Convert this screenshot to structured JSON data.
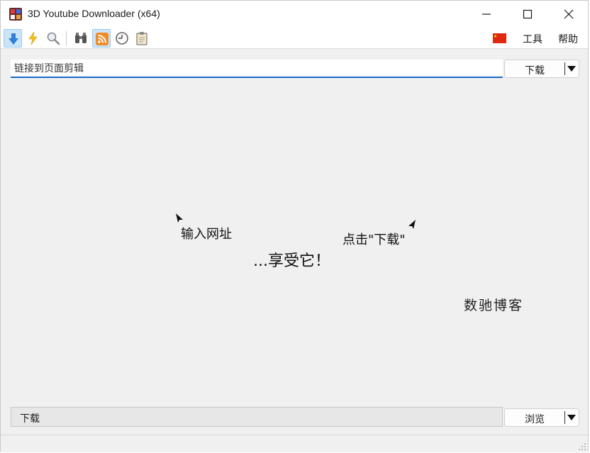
{
  "window": {
    "title": "3D Youtube Downloader (x64)",
    "app_icon": "app-logo-icon"
  },
  "titlebar_controls": [
    "minimize-icon",
    "maximize-icon",
    "close-icon"
  ],
  "toolbar": {
    "buttons": [
      {
        "icon": "download-arrow-icon",
        "active": true
      },
      {
        "icon": "lightning-icon",
        "active": false
      },
      {
        "icon": "magnifier-icon",
        "active": false
      },
      {
        "icon": "binoculars-icon",
        "active": false
      },
      {
        "icon": "rss-feed-icon",
        "active": true
      },
      {
        "icon": "clock-history-icon",
        "active": false
      },
      {
        "icon": "clipboard-icon",
        "active": false
      }
    ],
    "language_flag": "china-flag-icon",
    "menu": {
      "tools": "工具",
      "help": "帮助"
    }
  },
  "url_bar": {
    "placeholder": "链接到页面剪辑",
    "download_label": "下载"
  },
  "hints": {
    "enter_url": "输入网址",
    "click_download": "点击\"下载\"",
    "enjoy": "...享受它！"
  },
  "watermark": "数驰博客",
  "output": {
    "folder": "下载",
    "browse_label": "浏览"
  },
  "colors": {
    "accent": "#1c69c5",
    "window_bg": "#f0f0f0",
    "active_button": "#cce4f7",
    "flag_red": "#de2910",
    "flag_yellow": "#ffde00"
  }
}
